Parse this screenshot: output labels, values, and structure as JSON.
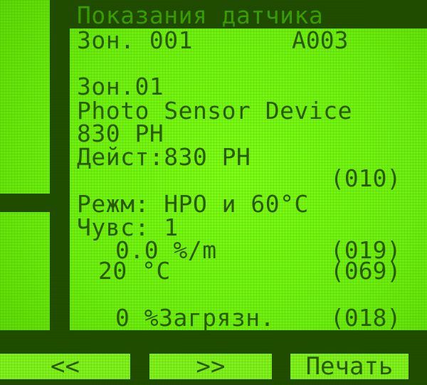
{
  "screen": {
    "title": "Показания датчика",
    "zone_header": {
      "zone": "Зон. 001",
      "address": "A003"
    },
    "zone_line": "Зон.01",
    "device_name": "Photo Sensor Device",
    "model": "830 PH",
    "actual": "Дейст:830 PH",
    "code_010": "(010)",
    "mode": "Режм: HPO и 60°C",
    "sensitivity": "Чувс: 1",
    "rate_value": "0.0 %/m",
    "code_019": "(019)",
    "temperature": "20 °C",
    "code_069": "(069)",
    "contamination": "0 %Загрязн.",
    "code_018": "(018)"
  },
  "softkeys": {
    "prev": "<<",
    "next": ">>",
    "print": "Печать"
  },
  "colors": {
    "lcd_bg": "#6df00c",
    "pixel_on": "#1f4a00",
    "title_text": "#3aa000"
  }
}
